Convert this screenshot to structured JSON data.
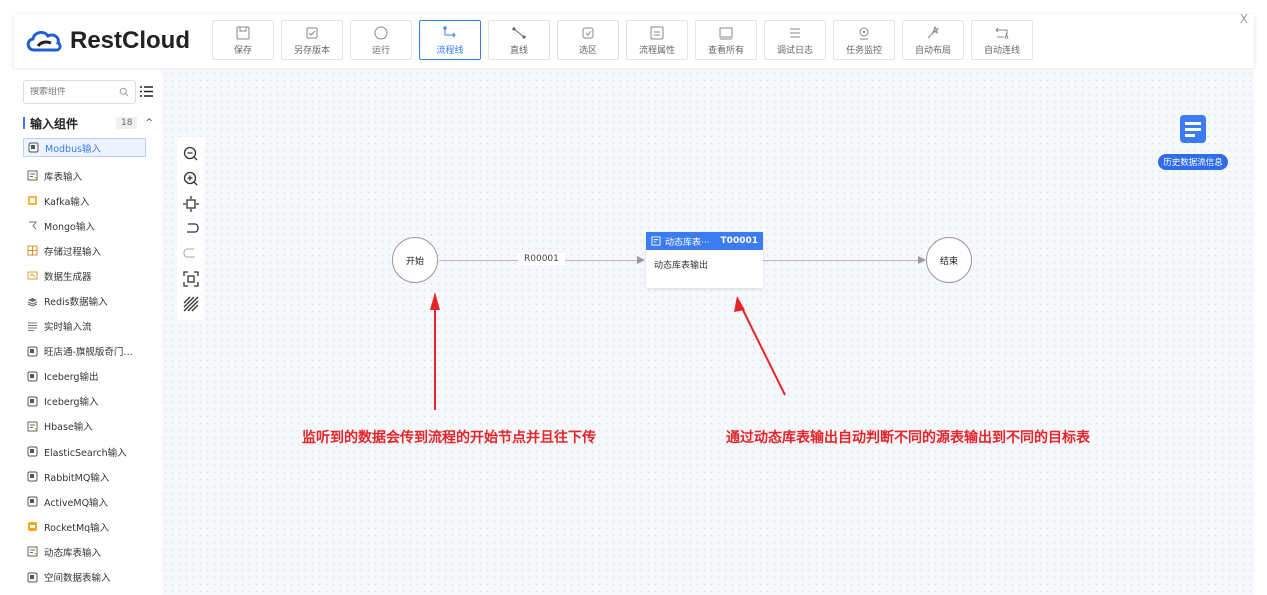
{
  "header": {
    "logo_text": "RestCloud",
    "close_label": "X",
    "tools": [
      {
        "label": "保存",
        "icon": "save-icon"
      },
      {
        "label": "另存版本",
        "icon": "save-version-icon"
      },
      {
        "label": "运行",
        "icon": "run-icon"
      },
      {
        "label": "流程线",
        "icon": "flow-line-icon",
        "active": true
      },
      {
        "label": "直线",
        "icon": "straight-line-icon"
      },
      {
        "label": "选区",
        "icon": "select-area-icon"
      },
      {
        "label": "流程属性",
        "icon": "flow-properties-icon"
      },
      {
        "label": "查看所有",
        "icon": "view-all-icon"
      },
      {
        "label": "调试日志",
        "icon": "debug-log-icon"
      },
      {
        "label": "任务监控",
        "icon": "task-monitor-icon"
      },
      {
        "label": "自动布局",
        "icon": "auto-layout-icon"
      },
      {
        "label": "自动连线",
        "icon": "auto-connect-icon"
      }
    ]
  },
  "sidebar": {
    "search_placeholder": "搜索组件",
    "group": {
      "title": "输入组件",
      "count": "18"
    },
    "items": [
      {
        "label": "Modbus输入",
        "icon": "modbus-icon",
        "active": true
      },
      {
        "label": "库表输入",
        "icon": "table-icon"
      },
      {
        "label": "Kafka输入",
        "icon": "kafka-icon"
      },
      {
        "label": "Mongo输入",
        "icon": "mongo-icon"
      },
      {
        "label": "存储过程输入",
        "icon": "procedure-icon"
      },
      {
        "label": "数据生成器",
        "icon": "generator-icon"
      },
      {
        "label": "Redis数据输入",
        "icon": "redis-icon"
      },
      {
        "label": "实时输入流",
        "icon": "stream-icon"
      },
      {
        "label": "旺店通-旗舰版奇门…",
        "icon": "component-icon"
      },
      {
        "label": "Iceberg输出",
        "icon": "component-icon"
      },
      {
        "label": "Iceberg输入",
        "icon": "component-icon"
      },
      {
        "label": "Hbase输入",
        "icon": "table-icon"
      },
      {
        "label": "ElasticSearch输入",
        "icon": "component-icon"
      },
      {
        "label": "RabbitMQ输入",
        "icon": "component-icon"
      },
      {
        "label": "ActiveMQ输入",
        "icon": "component-icon"
      },
      {
        "label": "RocketMq输入",
        "icon": "rocketmq-icon"
      },
      {
        "label": "动态库表输入",
        "icon": "table-icon"
      },
      {
        "label": "空间数据表输入",
        "icon": "component-icon"
      }
    ]
  },
  "canvas": {
    "history_label": "历史数据流信息",
    "start_node": "开始",
    "end_node": "结束",
    "edge_label": "R00001",
    "task": {
      "title": "动态库表···",
      "id": "T00001",
      "body": "动态库表输出"
    },
    "note_left": "监听到的数据会传到流程的开始节点并且往下传",
    "note_right": "通过动态库表输出自动判断不同的源表输出到不同的目标表"
  },
  "colors": {
    "accent": "#3b7cf0",
    "annotation": "#e5252a"
  }
}
